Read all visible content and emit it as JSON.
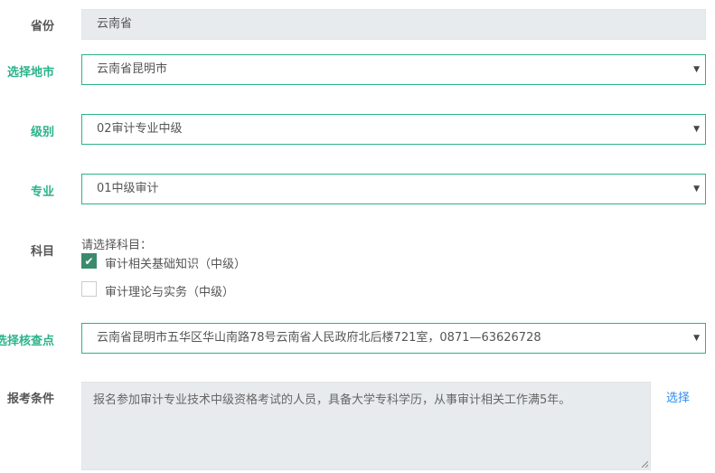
{
  "province": {
    "label": "省份",
    "value": "云南省"
  },
  "city": {
    "label": "选择地市",
    "value": "云南省昆明市"
  },
  "level": {
    "label": "级别",
    "value": "02审计专业中级"
  },
  "major": {
    "label": "专业",
    "value": "01中级审计"
  },
  "subject": {
    "label": "科目",
    "prompt": "请选择科目：",
    "options": [
      {
        "label": "审计相关基础知识（中级）",
        "checked": true
      },
      {
        "label": "审计理论与实务（中级）",
        "checked": false
      }
    ]
  },
  "site": {
    "label": "选择核查点",
    "value": "云南省昆明市五华区华山南路78号云南省人民政府北后楼721室，0871—63626728"
  },
  "conditions": {
    "label": "报考条件",
    "value": "报名参加审计专业技术中级资格考试的人员，具备大学专科学历，从事审计相关工作满5年。",
    "select_link": "选择"
  },
  "colors": {
    "accent": "#2bb38a",
    "link": "#2d8cf0",
    "checkbox": "#3a8a6e"
  }
}
